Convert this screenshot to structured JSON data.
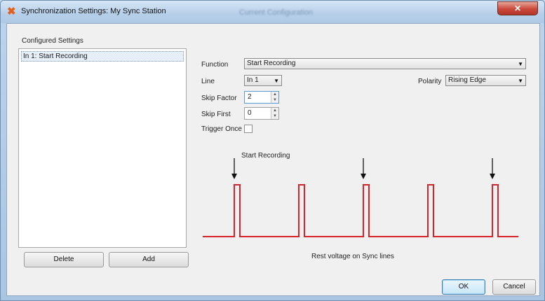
{
  "window": {
    "title": "Synchronization Settings: My Sync Station",
    "background_title": "Current Configuration",
    "close_icon": "close-x-icon",
    "app_icon": "app-logo-icon",
    "accent": "#e2601b"
  },
  "left_panel": {
    "heading": "Configured Settings",
    "items": [
      {
        "label": "In 1: Start Recording"
      }
    ],
    "delete_label": "Delete",
    "add_label": "Add"
  },
  "form": {
    "function_label": "Function",
    "function_value": "Start Recording",
    "line_label": "Line",
    "line_value": "In 1",
    "polarity_label": "Polarity",
    "polarity_value": "Rising Edge",
    "skip_factor_label": "Skip Factor",
    "skip_factor_value": "2",
    "skip_first_label": "Skip First",
    "skip_first_value": "0",
    "trigger_once_label": "Trigger Once",
    "trigger_once_checked": false
  },
  "diagram": {
    "caption": "Start Recording",
    "footer": "Rest voltage on Sync lines",
    "pulse_count": 5,
    "arrow_on_pulses": [
      1,
      3,
      5
    ],
    "line_color": "#d6232a"
  },
  "footer": {
    "ok_label": "OK",
    "cancel_label": "Cancel"
  }
}
